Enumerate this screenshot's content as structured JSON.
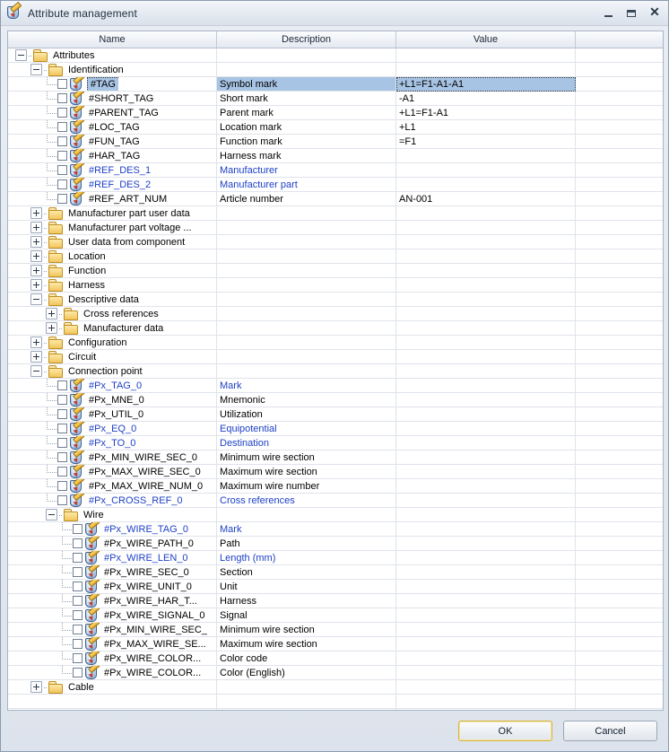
{
  "window": {
    "title": "Attribute management",
    "icon": "shield-pencil-icon",
    "controls": {
      "minimize": "minimize-icon",
      "maximize": "maximize-icon",
      "close": "close-icon"
    }
  },
  "grid": {
    "columns": [
      "Name",
      "Description",
      "Value",
      ""
    ],
    "rows": [
      {
        "type": "folder",
        "indent": 0,
        "expander": "minus",
        "name": "Attributes",
        "desc": "",
        "value": ""
      },
      {
        "type": "folder",
        "indent": 1,
        "expander": "minus",
        "name": "Identification",
        "desc": "",
        "value": ""
      },
      {
        "type": "attr",
        "indent": 2,
        "name": "#TAG",
        "desc": "Symbol mark",
        "value": "+L1=F1-A1-A1",
        "selected": true
      },
      {
        "type": "attr",
        "indent": 2,
        "name": "#SHORT_TAG",
        "desc": "Short mark",
        "value": "-A1"
      },
      {
        "type": "attr",
        "indent": 2,
        "name": "#PARENT_TAG",
        "desc": "Parent mark",
        "value": "+L1=F1-A1"
      },
      {
        "type": "attr",
        "indent": 2,
        "name": "#LOC_TAG",
        "desc": "Location mark",
        "value": "+L1"
      },
      {
        "type": "attr",
        "indent": 2,
        "name": "#FUN_TAG",
        "desc": "Function mark",
        "value": "=F1"
      },
      {
        "type": "attr",
        "indent": 2,
        "name": "#HAR_TAG",
        "desc": "Harness mark",
        "value": ""
      },
      {
        "type": "attr",
        "indent": 2,
        "name": "#REF_DES_1",
        "desc": "Manufacturer",
        "value": "",
        "blue": true
      },
      {
        "type": "attr",
        "indent": 2,
        "name": "#REF_DES_2",
        "desc": "Manufacturer part",
        "value": "",
        "blue": true
      },
      {
        "type": "attr",
        "indent": 2,
        "name": "#REF_ART_NUM",
        "desc": "Article number",
        "value": "AN-001"
      },
      {
        "type": "folder",
        "indent": 1,
        "expander": "plus",
        "name": "Manufacturer part user data",
        "desc": "",
        "value": ""
      },
      {
        "type": "folder",
        "indent": 1,
        "expander": "plus",
        "name": "Manufacturer part voltage ...",
        "desc": "",
        "value": ""
      },
      {
        "type": "folder",
        "indent": 1,
        "expander": "plus",
        "name": "User data from component",
        "desc": "",
        "value": ""
      },
      {
        "type": "folder",
        "indent": 1,
        "expander": "plus",
        "name": "Location",
        "desc": "",
        "value": ""
      },
      {
        "type": "folder",
        "indent": 1,
        "expander": "plus",
        "name": "Function",
        "desc": "",
        "value": ""
      },
      {
        "type": "folder",
        "indent": 1,
        "expander": "plus",
        "name": "Harness",
        "desc": "",
        "value": ""
      },
      {
        "type": "folder",
        "indent": 1,
        "expander": "minus",
        "name": "Descriptive data",
        "desc": "",
        "value": ""
      },
      {
        "type": "folder",
        "indent": 2,
        "expander": "plus",
        "name": "Cross references",
        "desc": "",
        "value": ""
      },
      {
        "type": "folder",
        "indent": 2,
        "expander": "plus",
        "name": "Manufacturer data",
        "desc": "",
        "value": ""
      },
      {
        "type": "folder",
        "indent": 1,
        "expander": "plus",
        "name": "Configuration",
        "desc": "",
        "value": ""
      },
      {
        "type": "folder",
        "indent": 1,
        "expander": "plus",
        "name": "Circuit",
        "desc": "",
        "value": ""
      },
      {
        "type": "folder",
        "indent": 1,
        "expander": "minus",
        "name": "Connection point",
        "desc": "",
        "value": ""
      },
      {
        "type": "attr",
        "indent": 2,
        "name": "#Px_TAG_0",
        "desc": "Mark",
        "value": "",
        "blue": true
      },
      {
        "type": "attr",
        "indent": 2,
        "name": "#Px_MNE_0",
        "desc": "Mnemonic",
        "value": ""
      },
      {
        "type": "attr",
        "indent": 2,
        "name": "#Px_UTIL_0",
        "desc": "Utilization",
        "value": ""
      },
      {
        "type": "attr",
        "indent": 2,
        "name": "#Px_EQ_0",
        "desc": "Equipotential",
        "value": "",
        "blue": true
      },
      {
        "type": "attr",
        "indent": 2,
        "name": "#Px_TO_0",
        "desc": "Destination",
        "value": "",
        "blue": true
      },
      {
        "type": "attr",
        "indent": 2,
        "name": "#Px_MIN_WIRE_SEC_0",
        "desc": "Minimum wire section",
        "value": ""
      },
      {
        "type": "attr",
        "indent": 2,
        "name": "#Px_MAX_WIRE_SEC_0",
        "desc": "Maximum wire section",
        "value": ""
      },
      {
        "type": "attr",
        "indent": 2,
        "name": "#Px_MAX_WIRE_NUM_0",
        "desc": "Maximum wire number",
        "value": ""
      },
      {
        "type": "attr",
        "indent": 2,
        "name": "#Px_CROSS_REF_0",
        "desc": "Cross references",
        "value": "",
        "blue": true
      },
      {
        "type": "folder",
        "indent": 2,
        "expander": "minus",
        "name": "Wire",
        "desc": "",
        "value": ""
      },
      {
        "type": "attr",
        "indent": 3,
        "name": "#Px_WIRE_TAG_0",
        "desc": "Mark",
        "value": "",
        "blue": true
      },
      {
        "type": "attr",
        "indent": 3,
        "name": "#Px_WIRE_PATH_0",
        "desc": "Path",
        "value": ""
      },
      {
        "type": "attr",
        "indent": 3,
        "name": "#Px_WIRE_LEN_0",
        "desc": "Length (mm)",
        "value": "",
        "blue": true
      },
      {
        "type": "attr",
        "indent": 3,
        "name": "#Px_WIRE_SEC_0",
        "desc": "Section",
        "value": ""
      },
      {
        "type": "attr",
        "indent": 3,
        "name": "#Px_WIRE_UNIT_0",
        "desc": "Unit",
        "value": ""
      },
      {
        "type": "attr",
        "indent": 3,
        "name": "#Px_WIRE_HAR_T...",
        "desc": "Harness",
        "value": ""
      },
      {
        "type": "attr",
        "indent": 3,
        "name": "#Px_WIRE_SIGNAL_0",
        "desc": "Signal",
        "value": ""
      },
      {
        "type": "attr",
        "indent": 3,
        "name": "#Px_MIN_WIRE_SEC_",
        "desc": "Minimum wire section",
        "value": ""
      },
      {
        "type": "attr",
        "indent": 3,
        "name": "#Px_MAX_WIRE_SE...",
        "desc": "Maximum wire section",
        "value": ""
      },
      {
        "type": "attr",
        "indent": 3,
        "name": "#Px_WIRE_COLOR...",
        "desc": "Color code",
        "value": ""
      },
      {
        "type": "attr",
        "indent": 3,
        "name": "#Px_WIRE_COLOR...",
        "desc": "Color (English)",
        "value": ""
      },
      {
        "type": "folder",
        "indent": 1,
        "expander": "plus",
        "name": "Cable",
        "desc": "",
        "value": ""
      },
      {
        "type": "empty",
        "indent": 0,
        "name": "",
        "desc": "",
        "value": ""
      },
      {
        "type": "empty",
        "indent": 0,
        "name": "",
        "desc": "",
        "value": ""
      }
    ]
  },
  "footer": {
    "ok_label": "OK",
    "cancel_label": "Cancel"
  },
  "colors": {
    "selection": "#a8c4e4",
    "link_text": "#1d3fc6",
    "folder": "#f2c55c",
    "title_text": "#22303f"
  }
}
